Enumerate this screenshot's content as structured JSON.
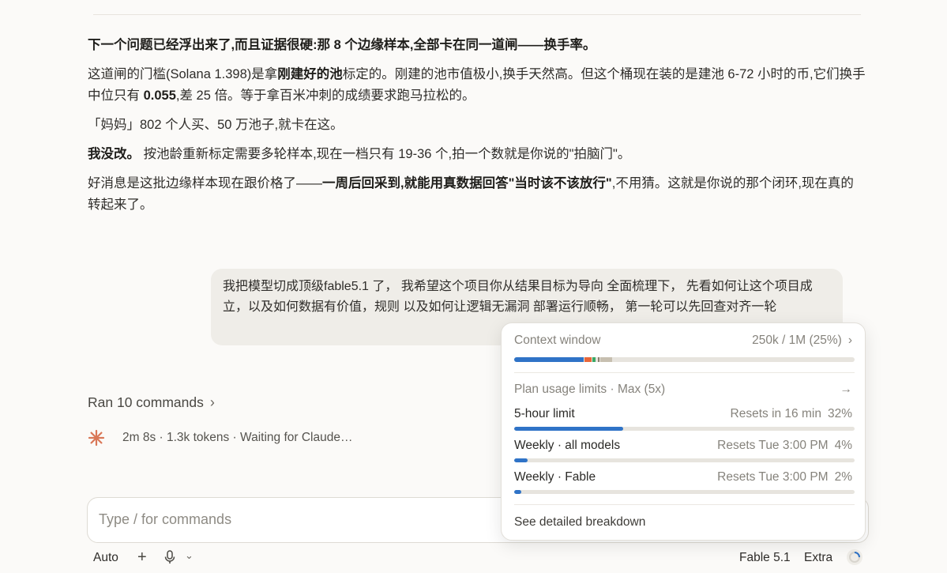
{
  "assistant": {
    "p1": "下一个问题已经浮出来了,而且证据很硬:那 8 个边缘样本,全部卡在同一道闸——换手率。",
    "p2_a": "这道闸的门槛(Solana 1.398)是拿",
    "p2_b": "刚建好的池",
    "p2_c": "标定的。刚建的池市值极小,换手天然高。但这个桶现在装的是建池 6-72 小时的币,它们换手中位只有 ",
    "p2_d": "0.055",
    "p2_e": ",差 25 倍。等于拿百米冲刺的成绩要求跑马拉松的。",
    "p3": "「妈妈」802 个人买、50 万池子,就卡在这。",
    "p4_a": "我没改。",
    "p4_b": " 按池龄重新标定需要多轮样本,现在一档只有 19-36 个,拍一个数就是你说的\"拍脑门\"。",
    "p5_a": "好消息是这批边缘样本现在跟价格了——",
    "p5_b": "一周后回采到,就能用真数据回答\"当时该不该放行\"",
    "p5_c": ",不用猜。这就是你说的那个闭环,现在真的转起来了。"
  },
  "user_message": "我把模型切成顶级fable5.1 了， 我希望这个项目你从结果目标为导向 全面梳理下， 先看如何让这个项目成立，以及如何数据有价值，规则 以及如何让逻辑无漏洞 部署运行顺畅， 第一轮可以先回查对齐一轮",
  "ran_commands": "Ran 10 commands",
  "status": "2m 8s · 1.3k tokens · Waiting for Claude…",
  "input": {
    "placeholder": "Type / for commands",
    "value": ""
  },
  "bottom": {
    "mode": "Auto",
    "model": "Fable 5.1",
    "extra": "Extra"
  },
  "popover": {
    "context_label": "Context window",
    "context_value": "250k / 1M (25%)",
    "context_fraction": 0.25,
    "plan_label": "Plan usage limits · Max (5x)",
    "limits": [
      {
        "name": "5-hour limit",
        "reset": "Resets in 16 min",
        "percent": "32%",
        "fraction": 0.32
      },
      {
        "name": "Weekly · all models",
        "reset": "Resets Tue 3:00 PM",
        "percent": "4%",
        "fraction": 0.04
      },
      {
        "name": "Weekly · Fable",
        "reset": "Resets Tue 3:00 PM",
        "percent": "2%",
        "fraction": 0.02
      }
    ],
    "breakdown_link": "See detailed breakdown"
  },
  "colors": {
    "accent": "#2f73c7",
    "spark": "#d97757",
    "ctx_orange": "#e8673a",
    "ctx_green": "#3aa865",
    "ctx_tan": "#c7bfb0"
  },
  "icons": [
    "chevron-right-icon",
    "spark-icon",
    "plus-icon",
    "microphone-icon",
    "chevron-down-icon",
    "arrow-right-icon",
    "usage-ring-icon"
  ]
}
